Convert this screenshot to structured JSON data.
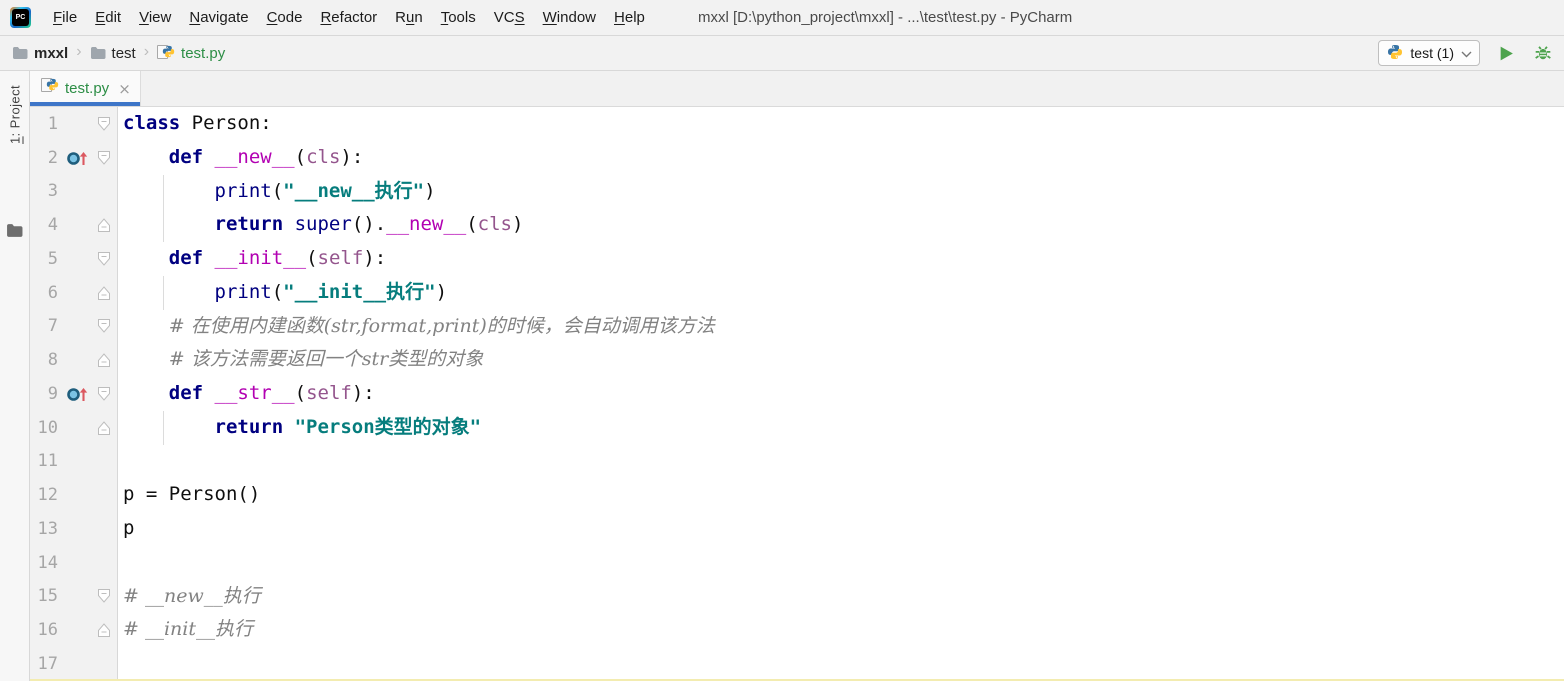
{
  "window": {
    "title": "mxxl [D:\\python_project\\mxxl] - ...\\test\\test.py - PyCharm",
    "logo_text": "PC"
  },
  "menu": {
    "items": [
      {
        "label": "File",
        "mnemonic_index": 0
      },
      {
        "label": "Edit",
        "mnemonic_index": 0
      },
      {
        "label": "View",
        "mnemonic_index": 0
      },
      {
        "label": "Navigate",
        "mnemonic_index": 0
      },
      {
        "label": "Code",
        "mnemonic_index": 0
      },
      {
        "label": "Refactor",
        "mnemonic_index": 0
      },
      {
        "label": "Run",
        "mnemonic_index": 1
      },
      {
        "label": "Tools",
        "mnemonic_index": 0
      },
      {
        "label": "VCS",
        "mnemonic_index": 2
      },
      {
        "label": "Window",
        "mnemonic_index": 0
      },
      {
        "label": "Help",
        "mnemonic_index": 0
      }
    ]
  },
  "breadcrumb": {
    "items": [
      {
        "label": "mxxl",
        "icon": "folder",
        "bold": true,
        "green": false
      },
      {
        "label": "test",
        "icon": "folder",
        "bold": false,
        "green": false
      },
      {
        "label": "test.py",
        "icon": "python-file",
        "bold": false,
        "green": true
      }
    ]
  },
  "run_widget": {
    "config_label": "test (1)"
  },
  "tool_stripe": {
    "project_label": "1: Project",
    "mnemonic_index": 0
  },
  "editor": {
    "tab": {
      "label": "test.py",
      "close_glyph": "×"
    },
    "lines": [
      {
        "n": 1,
        "fold": "start",
        "icon": null,
        "guide": false,
        "tokens": [
          {
            "c": "kw",
            "t": "class"
          },
          {
            "c": "pl",
            "t": " Person:"
          }
        ]
      },
      {
        "n": 2,
        "fold": "start",
        "icon": "overriding-method",
        "guide": false,
        "tokens": [
          {
            "c": "pl",
            "t": "    "
          },
          {
            "c": "kw",
            "t": "def"
          },
          {
            "c": "pl",
            "t": " "
          },
          {
            "c": "mg",
            "t": "__new__"
          },
          {
            "c": "pl",
            "t": "("
          },
          {
            "c": "pr",
            "t": "cls"
          },
          {
            "c": "pl",
            "t": "):"
          }
        ]
      },
      {
        "n": 3,
        "fold": null,
        "icon": null,
        "guide": true,
        "tokens": [
          {
            "c": "pl",
            "t": "        "
          },
          {
            "c": "bi",
            "t": "print"
          },
          {
            "c": "pl",
            "t": "("
          },
          {
            "c": "st",
            "t": "\"__new__执行\""
          },
          {
            "c": "pl",
            "t": ")"
          }
        ]
      },
      {
        "n": 4,
        "fold": "end",
        "icon": null,
        "guide": true,
        "tokens": [
          {
            "c": "pl",
            "t": "        "
          },
          {
            "c": "kw",
            "t": "return"
          },
          {
            "c": "pl",
            "t": " "
          },
          {
            "c": "bi",
            "t": "super"
          },
          {
            "c": "pl",
            "t": "()."
          },
          {
            "c": "mg",
            "t": "__new__"
          },
          {
            "c": "pl",
            "t": "("
          },
          {
            "c": "pr",
            "t": "cls"
          },
          {
            "c": "pl",
            "t": ")"
          }
        ]
      },
      {
        "n": 5,
        "fold": "start",
        "icon": null,
        "guide": false,
        "tokens": [
          {
            "c": "pl",
            "t": "    "
          },
          {
            "c": "kw",
            "t": "def"
          },
          {
            "c": "pl",
            "t": " "
          },
          {
            "c": "mg",
            "t": "__init__"
          },
          {
            "c": "pl",
            "t": "("
          },
          {
            "c": "pr",
            "t": "self"
          },
          {
            "c": "pl",
            "t": "):"
          }
        ]
      },
      {
        "n": 6,
        "fold": "end",
        "icon": null,
        "guide": true,
        "tokens": [
          {
            "c": "pl",
            "t": "        "
          },
          {
            "c": "bi",
            "t": "print"
          },
          {
            "c": "pl",
            "t": "("
          },
          {
            "c": "st",
            "t": "\"__init__执行\""
          },
          {
            "c": "pl",
            "t": ")"
          }
        ]
      },
      {
        "n": 7,
        "fold": "start",
        "icon": null,
        "guide": false,
        "tokens": [
          {
            "c": "pl",
            "t": "    "
          },
          {
            "c": "cm",
            "t": "# 在使用内建函数(str,format,print)的时候，会自动调用该方法"
          }
        ]
      },
      {
        "n": 8,
        "fold": "end",
        "icon": null,
        "guide": false,
        "tokens": [
          {
            "c": "pl",
            "t": "    "
          },
          {
            "c": "cm",
            "t": "# 该方法需要返回一个str类型的对象"
          }
        ]
      },
      {
        "n": 9,
        "fold": "start",
        "icon": "overriding-method",
        "guide": false,
        "tokens": [
          {
            "c": "pl",
            "t": "    "
          },
          {
            "c": "kw",
            "t": "def"
          },
          {
            "c": "pl",
            "t": " "
          },
          {
            "c": "mg",
            "t": "__str__"
          },
          {
            "c": "pl",
            "t": "("
          },
          {
            "c": "pr",
            "t": "self"
          },
          {
            "c": "pl",
            "t": "):"
          }
        ]
      },
      {
        "n": 10,
        "fold": "end",
        "icon": null,
        "guide": true,
        "tokens": [
          {
            "c": "pl",
            "t": "        "
          },
          {
            "c": "kw",
            "t": "return"
          },
          {
            "c": "pl",
            "t": " "
          },
          {
            "c": "st",
            "t": "\"Person类型的对象\""
          }
        ]
      },
      {
        "n": 11,
        "fold": null,
        "icon": null,
        "guide": false,
        "tokens": []
      },
      {
        "n": 12,
        "fold": null,
        "icon": null,
        "guide": false,
        "tokens": [
          {
            "c": "pl",
            "t": "p = Person()"
          }
        ]
      },
      {
        "n": 13,
        "fold": null,
        "icon": null,
        "guide": false,
        "tokens": [
          {
            "c": "pl",
            "t": "p"
          }
        ]
      },
      {
        "n": 14,
        "fold": null,
        "icon": null,
        "guide": false,
        "tokens": []
      },
      {
        "n": 15,
        "fold": "start",
        "icon": null,
        "guide": false,
        "tokens": [
          {
            "c": "cm",
            "t": "# __new__执行"
          }
        ]
      },
      {
        "n": 16,
        "fold": "end",
        "icon": null,
        "guide": false,
        "tokens": [
          {
            "c": "cm",
            "t": "# __init__执行"
          }
        ]
      },
      {
        "n": 17,
        "fold": null,
        "icon": null,
        "guide": false,
        "tokens": []
      }
    ]
  },
  "colors": {
    "accent_tab_underline": "#3E76C8",
    "vcs_added_green": "#2D8E46",
    "keyword": "#000080",
    "magic_method": "#B200B2",
    "self_parameter": "#94558D",
    "string": "#067D7D",
    "comment": "#828282",
    "run_icon_green": "#4DA34D",
    "override_arrow_red": "#DB5860",
    "gutter_bg": "#F2F2F2"
  }
}
